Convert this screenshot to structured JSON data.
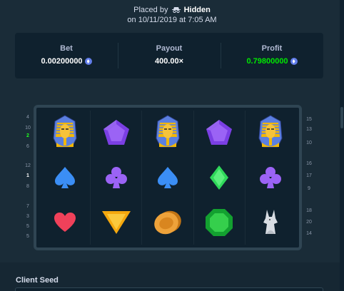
{
  "header": {
    "placed_by_prefix": "Placed by",
    "username": "Hidden",
    "date_line": "on 10/11/2019 at 7:05 AM"
  },
  "stats": {
    "bet_label": "Bet",
    "bet_value": "0.00200000",
    "payout_label": "Payout",
    "payout_value": "400.00×",
    "profit_label": "Profit",
    "profit_value": "0.79800000",
    "currency_icon": "eth-coin-icon"
  },
  "reel_numbers_left": [
    {
      "text": "4",
      "state": "normal"
    },
    {
      "text": "10",
      "state": "normal"
    },
    {
      "text": "2",
      "state": "green"
    },
    {
      "text": "6",
      "state": "normal"
    },
    {
      "text": "12",
      "state": "normal"
    },
    {
      "text": "1",
      "state": "active"
    },
    {
      "text": "8",
      "state": "normal"
    },
    {
      "text": "7",
      "state": "normal"
    },
    {
      "text": "3",
      "state": "normal"
    },
    {
      "text": "5",
      "state": "normal"
    },
    {
      "text": "5",
      "state": "normal"
    }
  ],
  "reel_numbers_right": [
    {
      "text": "15",
      "state": "normal"
    },
    {
      "text": "13",
      "state": "normal"
    },
    {
      "text": "10",
      "state": "normal"
    },
    {
      "text": "16",
      "state": "normal"
    },
    {
      "text": "17",
      "state": "normal"
    },
    {
      "text": "9",
      "state": "normal"
    },
    {
      "text": "18",
      "state": "normal"
    },
    {
      "text": "20",
      "state": "normal"
    },
    {
      "text": "14",
      "state": "normal"
    }
  ],
  "reels": [
    [
      "pharaoh-icon",
      "spade-icon",
      "heart-icon"
    ],
    [
      "pentagon-gem-icon",
      "club-icon",
      "triangle-gem-icon"
    ],
    [
      "pharaoh-icon",
      "spade-icon",
      "coin-stack-icon"
    ],
    [
      "pentagon-gem-icon",
      "diamond-icon",
      "emerald-icon"
    ],
    [
      "pharaoh-icon",
      "club-icon",
      "anubis-icon"
    ]
  ],
  "client_seed_label": "Client Seed",
  "colors": {
    "background": "#1a2c38",
    "panel": "#0f212e",
    "frame": "#2f4553",
    "profit_green": "#00e701"
  }
}
